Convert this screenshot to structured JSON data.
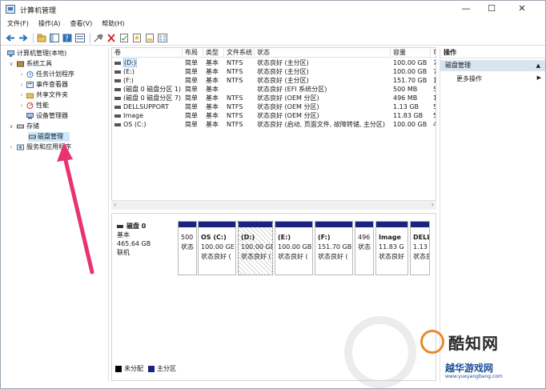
{
  "window": {
    "title": "计算机管理"
  },
  "menu": [
    "文件(F)",
    "操作(A)",
    "查看(V)",
    "帮助(H)"
  ],
  "tree": [
    {
      "label": "计算机管理(本地)",
      "level": 0,
      "expanded": true
    },
    {
      "label": "系统工具",
      "level": 1,
      "expanded": true
    },
    {
      "label": "任务计划程序",
      "level": 2,
      "expanded": false
    },
    {
      "label": "事件查看器",
      "level": 2,
      "expanded": false
    },
    {
      "label": "共享文件夹",
      "level": 2,
      "expanded": false
    },
    {
      "label": "性能",
      "level": 2,
      "expanded": false
    },
    {
      "label": "设备管理器",
      "level": 2,
      "expanded": null
    },
    {
      "label": "存储",
      "level": 1,
      "expanded": true
    },
    {
      "label": "磁盘管理",
      "level": 2,
      "expanded": null,
      "selected": true
    },
    {
      "label": "服务和应用程序",
      "level": 1,
      "expanded": false
    }
  ],
  "volume_table": {
    "columns": [
      "卷",
      "布局",
      "类型",
      "文件系统",
      "状态",
      "容量",
      "可"
    ],
    "rows": [
      {
        "volume": "(D:)",
        "layout": "简单",
        "type": "基本",
        "fs": "NTFS",
        "status": "状态良好 (主分区)",
        "capacity": "100.00 GB",
        "free": "7",
        "selected": true
      },
      {
        "volume": "(E:)",
        "layout": "简单",
        "type": "基本",
        "fs": "NTFS",
        "status": "状态良好 (主分区)",
        "capacity": "100.00 GB",
        "free": "7"
      },
      {
        "volume": "(F:)",
        "layout": "简单",
        "type": "基本",
        "fs": "NTFS",
        "status": "状态良好 (主分区)",
        "capacity": "151.70 GB",
        "free": "1"
      },
      {
        "volume": "(磁盘 0 磁盘分区 1)",
        "layout": "简单",
        "type": "基本",
        "fs": "",
        "status": "状态良好 (EFI 系统分区)",
        "capacity": "500 MB",
        "free": "5"
      },
      {
        "volume": "(磁盘 0 磁盘分区 7)",
        "layout": "简单",
        "type": "基本",
        "fs": "NTFS",
        "status": "状态良好 (OEM 分区)",
        "capacity": "496 MB",
        "free": "1"
      },
      {
        "volume": "DELLSUPPORT",
        "layout": "简单",
        "type": "基本",
        "fs": "NTFS",
        "status": "状态良好 (OEM 分区)",
        "capacity": "1.13 GB",
        "free": "5"
      },
      {
        "volume": "Image",
        "layout": "简单",
        "type": "基本",
        "fs": "NTFS",
        "status": "状态良好 (OEM 分区)",
        "capacity": "11.83 GB",
        "free": "5"
      },
      {
        "volume": "OS (C:)",
        "layout": "简单",
        "type": "基本",
        "fs": "NTFS",
        "status": "状态良好 (启动, 页面文件, 故障转储, 主分区)",
        "capacity": "100.00 GB",
        "free": "4"
      }
    ]
  },
  "disk": {
    "name": "磁盘 0",
    "type": "基本",
    "size": "465.64 GB",
    "state": "联机",
    "partitions": [
      {
        "name": "",
        "size": "500",
        "status": "状态"
      },
      {
        "name": "OS  (C:)",
        "size": "100.00 GE",
        "status": "状态良好 ("
      },
      {
        "name": "(D:)",
        "size": "100.00 GE",
        "status": "状态良好 (",
        "hatched": true
      },
      {
        "name": "(E:)",
        "size": "100.00 GB",
        "status": "状态良好 ("
      },
      {
        "name": "(F:)",
        "size": "151.70 GB",
        "status": "状态良好 ("
      },
      {
        "name": "",
        "size": "496",
        "status": "状态"
      },
      {
        "name": "Image",
        "size": "11.83 G",
        "status": "状态良好"
      },
      {
        "name": "DELL",
        "size": "1.13 (",
        "status": "状态良"
      }
    ]
  },
  "legend": [
    {
      "label": "未分配",
      "color": "#000000"
    },
    {
      "label": "主分区",
      "color": "#1a237e"
    }
  ],
  "actions": {
    "header": "操作",
    "section": "磁盘管理",
    "more": "更多操作"
  },
  "watermarks": {
    "brand": "酷知网",
    "site_name": "越华游戏网",
    "site_url": "www.yueyangbang.com"
  },
  "colors": {
    "accent": "#cce8ff",
    "partition_bar": "#1a237e",
    "arrow": "#e8336f"
  }
}
